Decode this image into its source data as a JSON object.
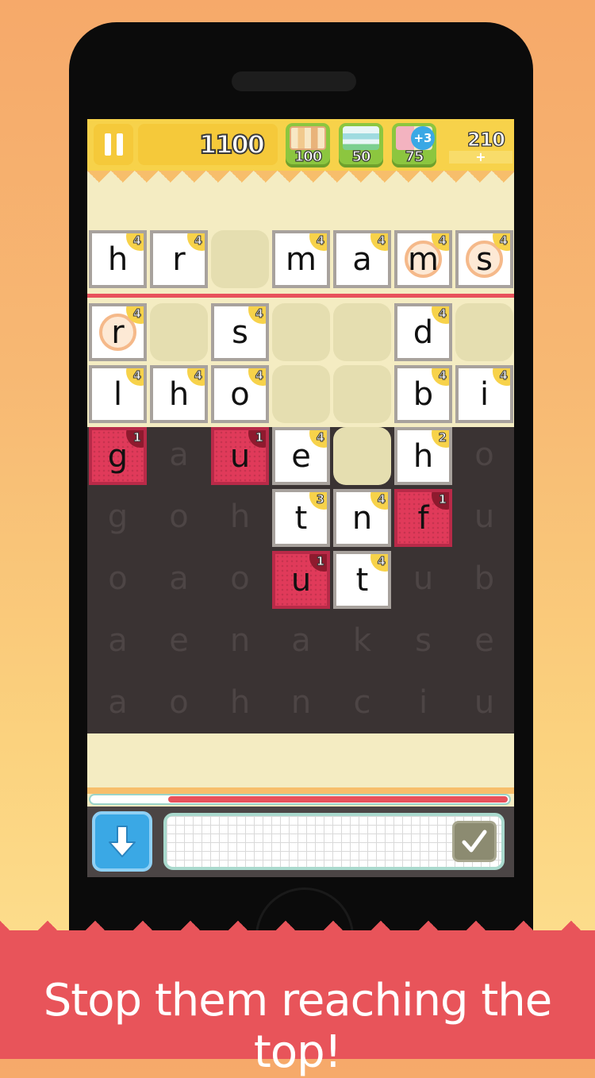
{
  "hud": {
    "score": "1100",
    "coins": "210",
    "coins_add": "+",
    "powerups": [
      {
        "cost": "100",
        "icon": "shuffle-tiles-icon"
      },
      {
        "cost": "50",
        "icon": "clear-row-icon"
      },
      {
        "cost": "75",
        "icon": "add-time-icon",
        "badge": "+3"
      }
    ]
  },
  "ghost_letters": [
    [
      "",
      "a",
      "",
      "",
      "",
      "",
      "o"
    ],
    [
      "g",
      "o",
      "h",
      "",
      "",
      "",
      "u"
    ],
    [
      "o",
      "a",
      "o",
      "",
      "",
      "u",
      "b"
    ],
    [
      "a",
      "e",
      "n",
      "a",
      "k",
      "s",
      "e"
    ],
    [
      "a",
      "o",
      "h",
      "n",
      "c",
      "i",
      "u"
    ]
  ],
  "top_row": [
    {
      "letter": "h",
      "points": "4"
    },
    {
      "letter": "r",
      "points": "4"
    },
    {
      "letter": "",
      "points": ""
    },
    {
      "letter": "m",
      "points": "4"
    },
    {
      "letter": "a",
      "points": "4"
    },
    {
      "letter": "m",
      "points": "4",
      "ring": true
    },
    {
      "letter": "s",
      "points": "4",
      "ring": true
    }
  ],
  "tiles": [
    {
      "letter": "r",
      "points": "4",
      "ring": true
    },
    {
      "letter": "s",
      "points": "4"
    },
    {
      "letter": "d",
      "points": "4"
    },
    {
      "letter": "l",
      "points": "4"
    },
    {
      "letter": "h",
      "points": "4"
    },
    {
      "letter": "o",
      "points": "4"
    },
    {
      "letter": "b",
      "points": "4"
    },
    {
      "letter": "i",
      "points": "4"
    },
    {
      "letter": "g",
      "points": "1",
      "red": true
    },
    {
      "letter": "u",
      "points": "1",
      "red": true
    },
    {
      "letter": "e",
      "points": "4"
    },
    {
      "letter": "h",
      "points": "2"
    },
    {
      "letter": "t",
      "points": "3"
    },
    {
      "letter": "n",
      "points": "4"
    },
    {
      "letter": "f",
      "points": "1",
      "red": true
    },
    {
      "letter": "u",
      "points": "1",
      "red": true
    },
    {
      "letter": "t",
      "points": "4"
    }
  ],
  "timer_progress": 0.81,
  "banner": "Stop them reaching the top!"
}
